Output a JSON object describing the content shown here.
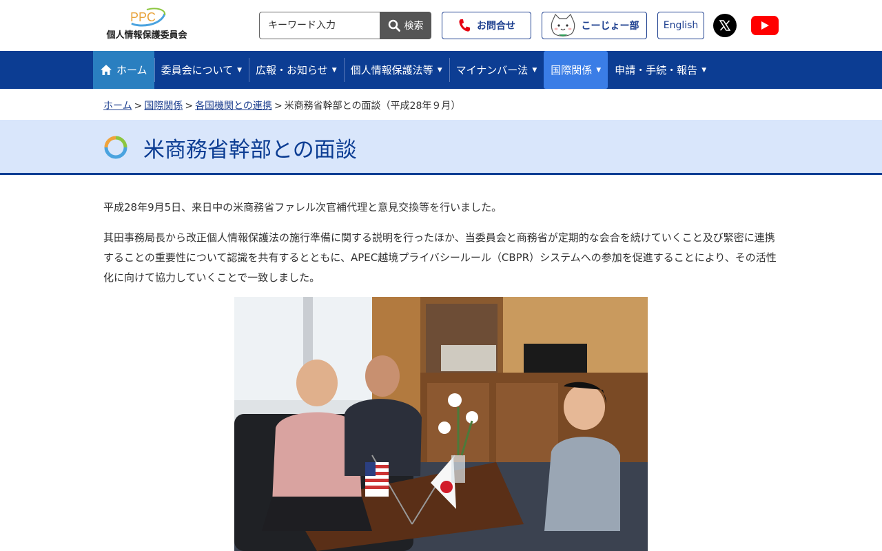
{
  "header": {
    "logo": {
      "mark": "PPC",
      "text": "個人情報保護委員会"
    },
    "search": {
      "placeholder": "キーワード入力",
      "button_label": "検索"
    },
    "contact_label": "お問合せ",
    "kojo_label": "こーじょー部",
    "english_label": "English"
  },
  "nav": {
    "items": [
      {
        "label": "ホーム"
      },
      {
        "label": "委員会について"
      },
      {
        "label": "広報・お知らせ"
      },
      {
        "label": "個人情報保護法等"
      },
      {
        "label": "マイナンバー法"
      },
      {
        "label": "国際関係"
      },
      {
        "label": "申請・手続・報告"
      }
    ],
    "active": "国際関係"
  },
  "breadcrumb": {
    "items": [
      "ホーム",
      "国際関係",
      "各国機関との連携"
    ],
    "current": "米商務省幹部との面談（平成28年９月）"
  },
  "page": {
    "title": "米商務省幹部との面談",
    "paragraphs": [
      "平成28年9月5日、来日中の米商務省ファレル次官補代理と意見交換等を行いました。",
      "其田事務局長から改正個人情報保護法の施行準備に関する説明を行ったほか、当委員会と商務省が定期的な会合を続けていくこと及び緊密に連携することの重要性について認識を共有するとともに、APEC越境プライバシールール（CBPR）システムへの参加を促進することにより、その活性化に向けて協力していくことで一致しました。"
    ]
  },
  "colors": {
    "nav_bg": "#0c3d93",
    "nav_active": "#3a7de6",
    "home_bg": "#2a7fc0",
    "title_band": "#d9e6fb",
    "accent": "#1d3f8f"
  }
}
